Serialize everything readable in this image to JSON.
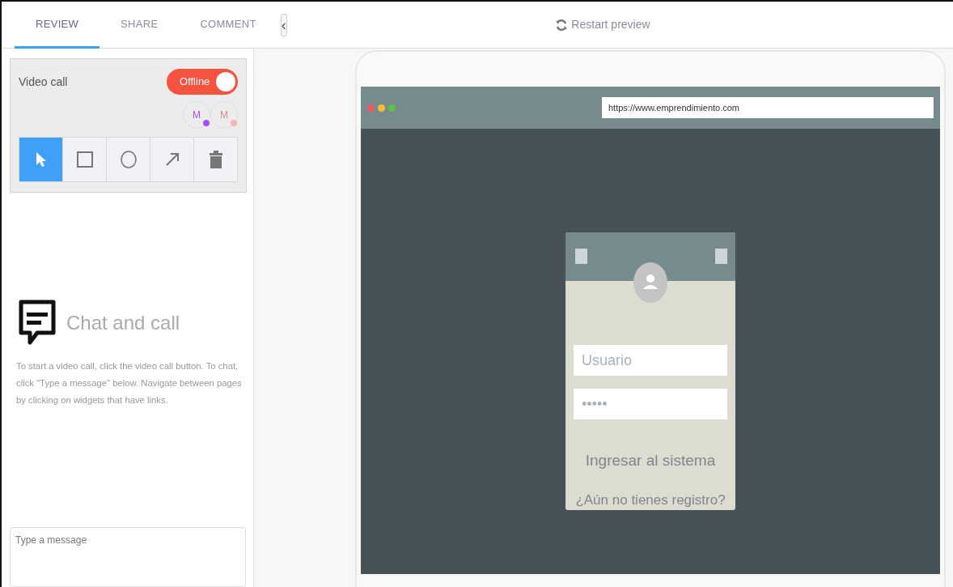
{
  "tabs": [
    {
      "label": "REVIEW",
      "selected": true
    },
    {
      "label": "SHARE",
      "selected": false
    },
    {
      "label": "COMMENT",
      "selected": false
    }
  ],
  "collapse_button": {
    "label": "‹"
  },
  "restart": {
    "label": "Restart preview"
  },
  "video_call": {
    "label": "Video call",
    "toggle": {
      "label": "Offline"
    },
    "participants": [
      {
        "initial": "M",
        "color": "#a64dff"
      },
      {
        "initial": "M",
        "color": "#f4b6b6"
      }
    ],
    "tools": [
      {
        "kind": "pointer",
        "selected": true
      },
      {
        "kind": "rectangle",
        "selected": false
      },
      {
        "kind": "circle",
        "selected": false
      },
      {
        "kind": "arrow",
        "selected": false
      },
      {
        "kind": "trash",
        "selected": false
      }
    ]
  },
  "chat": {
    "title": "Chat and call",
    "text": "To start a video call, click the video call button. To chat, click \"Type a message\" below. Navigate between pages by clicking on widgets that have links.",
    "message": {
      "placeholder": "Type a message"
    }
  },
  "preview": {
    "url": "https://www.emprendimiento.com",
    "login": {
      "username": {
        "placeholder": "Usuario"
      },
      "password": {
        "placeholder": "•••••"
      },
      "submit": "Ingresar al sistema",
      "register": "¿Aún no tienes registro?"
    }
  }
}
